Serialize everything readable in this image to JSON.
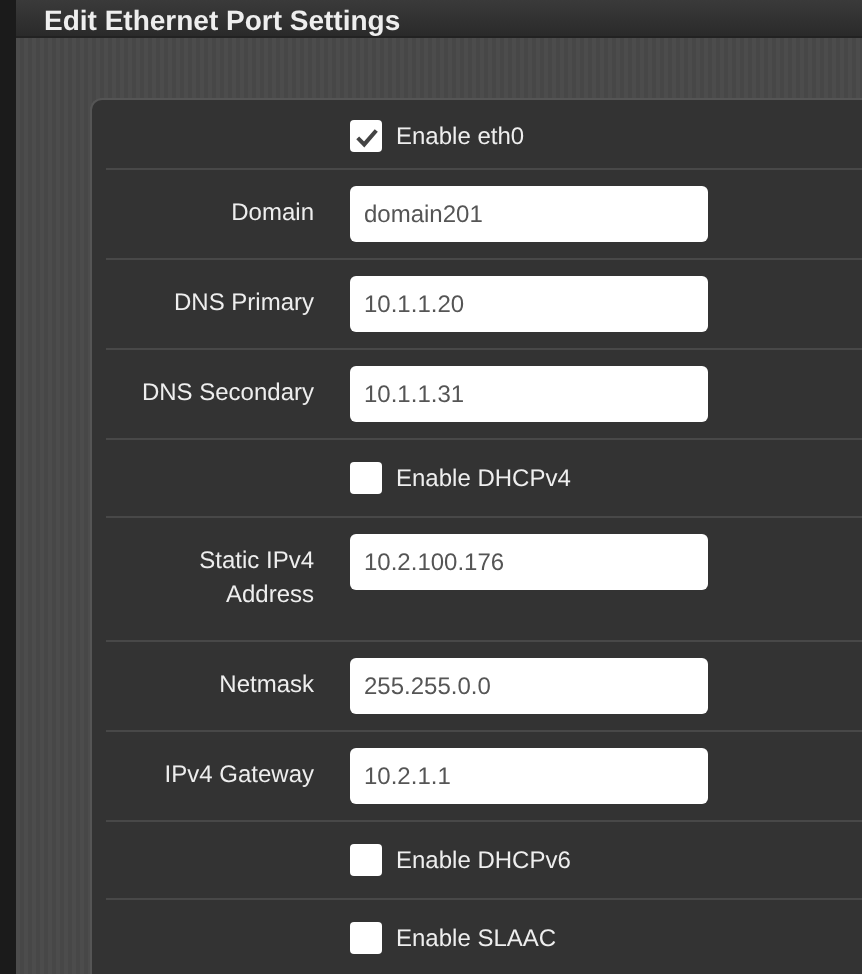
{
  "window": {
    "title": "Edit Ethernet Port Settings"
  },
  "rows": [
    {
      "kind": "checkbox",
      "label": "Enable eth0",
      "checked": true
    },
    {
      "kind": "field",
      "label": "Domain",
      "value": "domain201"
    },
    {
      "kind": "field",
      "label": "DNS Primary",
      "value": "10.1.1.20"
    },
    {
      "kind": "field",
      "label": "DNS Secondary",
      "value": "10.1.1.31"
    },
    {
      "kind": "checkbox",
      "label": "Enable DHCPv4",
      "checked": false
    },
    {
      "kind": "field",
      "label": "Static IPv4 Address",
      "value": "10.2.100.176"
    },
    {
      "kind": "field",
      "label": "Netmask",
      "value": "255.255.0.0"
    },
    {
      "kind": "field",
      "label": "IPv4 Gateway",
      "value": "10.2.1.1"
    },
    {
      "kind": "checkbox",
      "label": "Enable DHCPv6",
      "checked": false
    },
    {
      "kind": "checkbox",
      "label": "Enable SLAAC",
      "checked": false
    }
  ]
}
